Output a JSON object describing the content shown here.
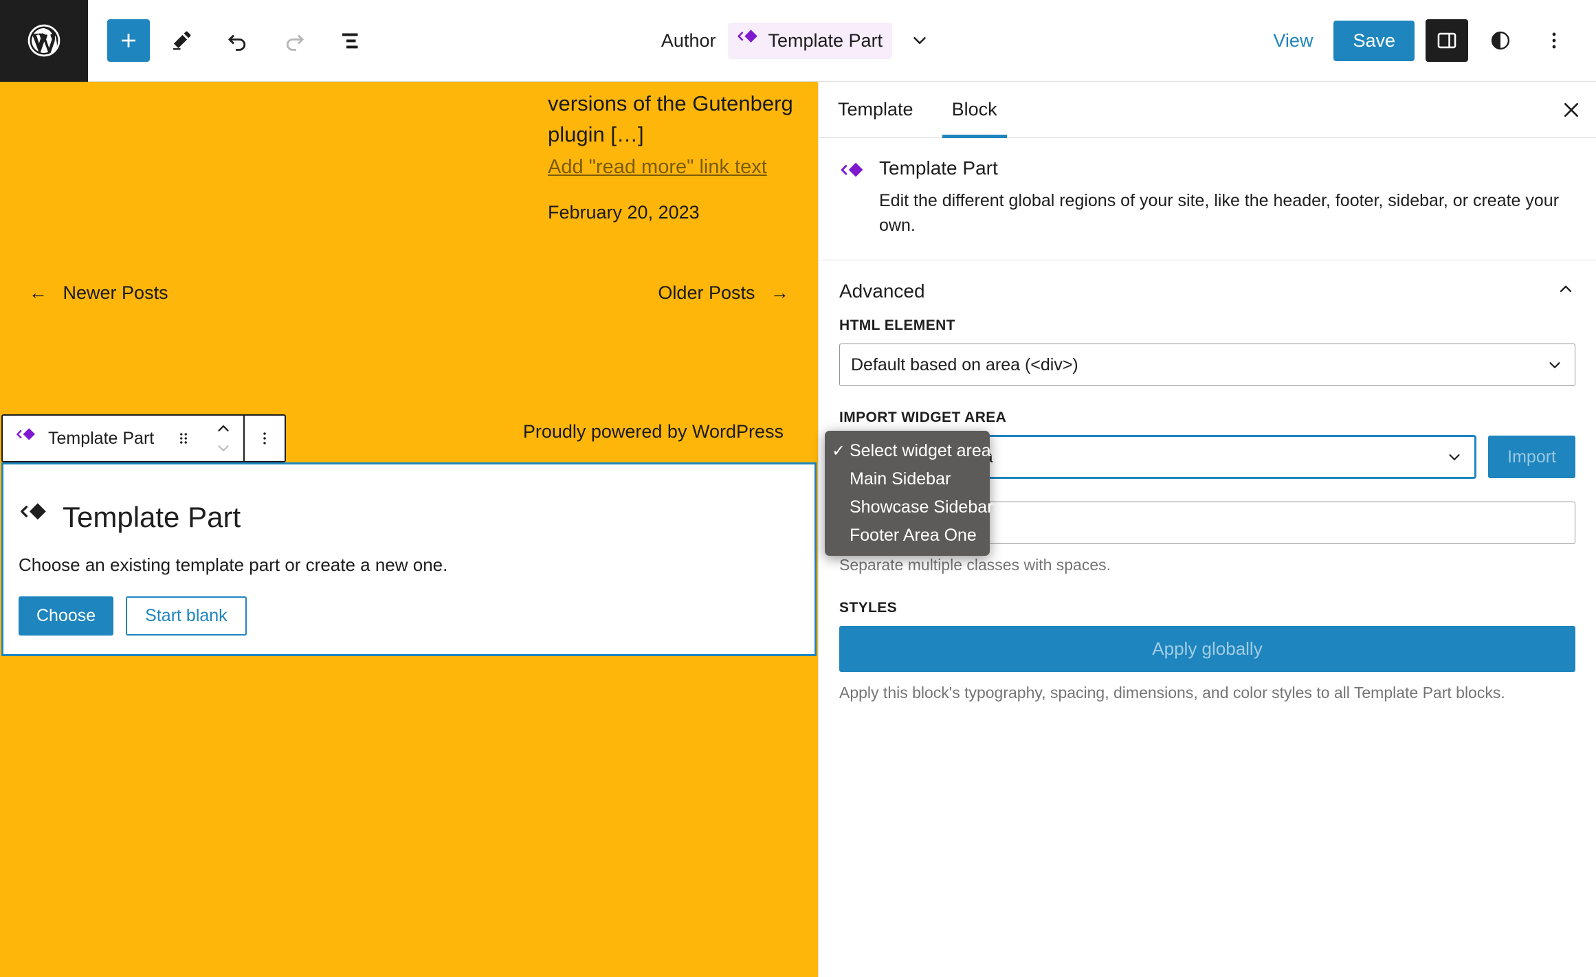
{
  "header": {
    "logo_icon": "wordpress-logo-icon",
    "tools": [
      {
        "name": "add-block-button",
        "icon": "plus-icon",
        "label": "Add block"
      },
      {
        "name": "edit-tool-button",
        "icon": "pencil-icon",
        "label": "Edit"
      },
      {
        "name": "undo-button",
        "icon": "undo-icon",
        "label": "Undo"
      },
      {
        "name": "redo-button",
        "icon": "redo-icon",
        "label": "Redo",
        "disabled": true
      },
      {
        "name": "list-view-button",
        "icon": "list-view-icon",
        "label": "Document Overview"
      }
    ],
    "document_area_label": "Author",
    "document_chip": {
      "icon": "template-part-icon",
      "label": "Template Part"
    },
    "chevron_icon": "chevron-down-icon",
    "view_label": "View",
    "save_label": "Save",
    "sidebar_toggle_icon": "sidebar-toggle-icon",
    "styles_icon": "contrast-styles-icon",
    "options_icon": "ellipsis-vertical-icon"
  },
  "canvas": {
    "background_color": "#ffb60b",
    "post_excerpt_tail": "versions of the Gutenberg plugin […]",
    "read_more_placeholder": "Add \"read more\" link text",
    "post_date": "February 20, 2023",
    "pagination": {
      "newer_arrow": "←",
      "newer_label": "Newer Posts",
      "older_label": "Older Posts",
      "older_arrow": "→"
    },
    "colophon_prefix": "Proudly powered by ",
    "colophon_link": "WordPress",
    "block_toolbar": {
      "block_icon": "template-part-icon",
      "block_label": "Template Part",
      "drag_icon": "drag-handle-icon",
      "move_up_icon": "chevron-up-icon",
      "move_down_icon": "chevron-down-icon",
      "options_icon": "ellipsis-vertical-icon"
    },
    "placeholder": {
      "icon": "template-part-icon",
      "title": "Template Part",
      "description": "Choose an existing template part or create a new one.",
      "choose_label": "Choose",
      "start_blank_label": "Start blank"
    }
  },
  "sidebar": {
    "tabs": [
      {
        "label": "Template",
        "active": false
      },
      {
        "label": "Block",
        "active": true
      }
    ],
    "close_icon": "close-icon",
    "block_card": {
      "icon": "template-part-icon",
      "title": "Template Part",
      "description": "Edit the different global regions of your site, like the header, footer, sidebar, or create your own."
    },
    "advanced_panel": {
      "title": "Advanced",
      "toggle_icon": "chevron-up-icon",
      "html_element": {
        "label": "HTML element",
        "value": "Default based on area (<div>)",
        "chevron_icon": "chevron-down-icon"
      },
      "import_widget_area": {
        "label": "Import widget area",
        "selected_value": "Select widget area",
        "chevron_icon": "chevron-down-icon",
        "import_label": "Import",
        "options": [
          {
            "label": "Select widget area",
            "selected": true
          },
          {
            "label": "Main Sidebar",
            "selected": false
          },
          {
            "label": "Showcase Sidebar",
            "selected": false
          },
          {
            "label": "Footer Area One",
            "selected": false
          }
        ]
      },
      "additional_css_classes": {
        "value": "",
        "help": "Separate multiple classes with spaces."
      },
      "styles": {
        "label": "Styles",
        "apply_globally_label": "Apply globally",
        "help": "Apply this block's typography, spacing, dimensions, and color styles to all Template Part blocks."
      }
    }
  },
  "colors": {
    "accent_blue": "#1e85be",
    "canvas_orange": "#ffb60b",
    "block_purple": "#7f19d0",
    "popup_gray": "#5d5b59"
  }
}
